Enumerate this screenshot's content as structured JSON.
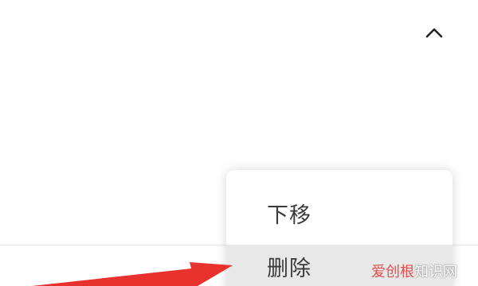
{
  "icons": {
    "collapse": "chevron-up-icon",
    "arrow": "red-arrow-pointer"
  },
  "context_menu": {
    "items": [
      {
        "label": "下移"
      },
      {
        "label": "删除",
        "highlighted": true
      }
    ]
  },
  "watermark": {
    "part1": "爱创根",
    "part2": "知识网"
  },
  "colors": {
    "arrow": "#e8322d",
    "highlight_row": "#e8e8e8",
    "menu_text": "#3a3a3a",
    "watermark_accent": "#e04f4f"
  }
}
